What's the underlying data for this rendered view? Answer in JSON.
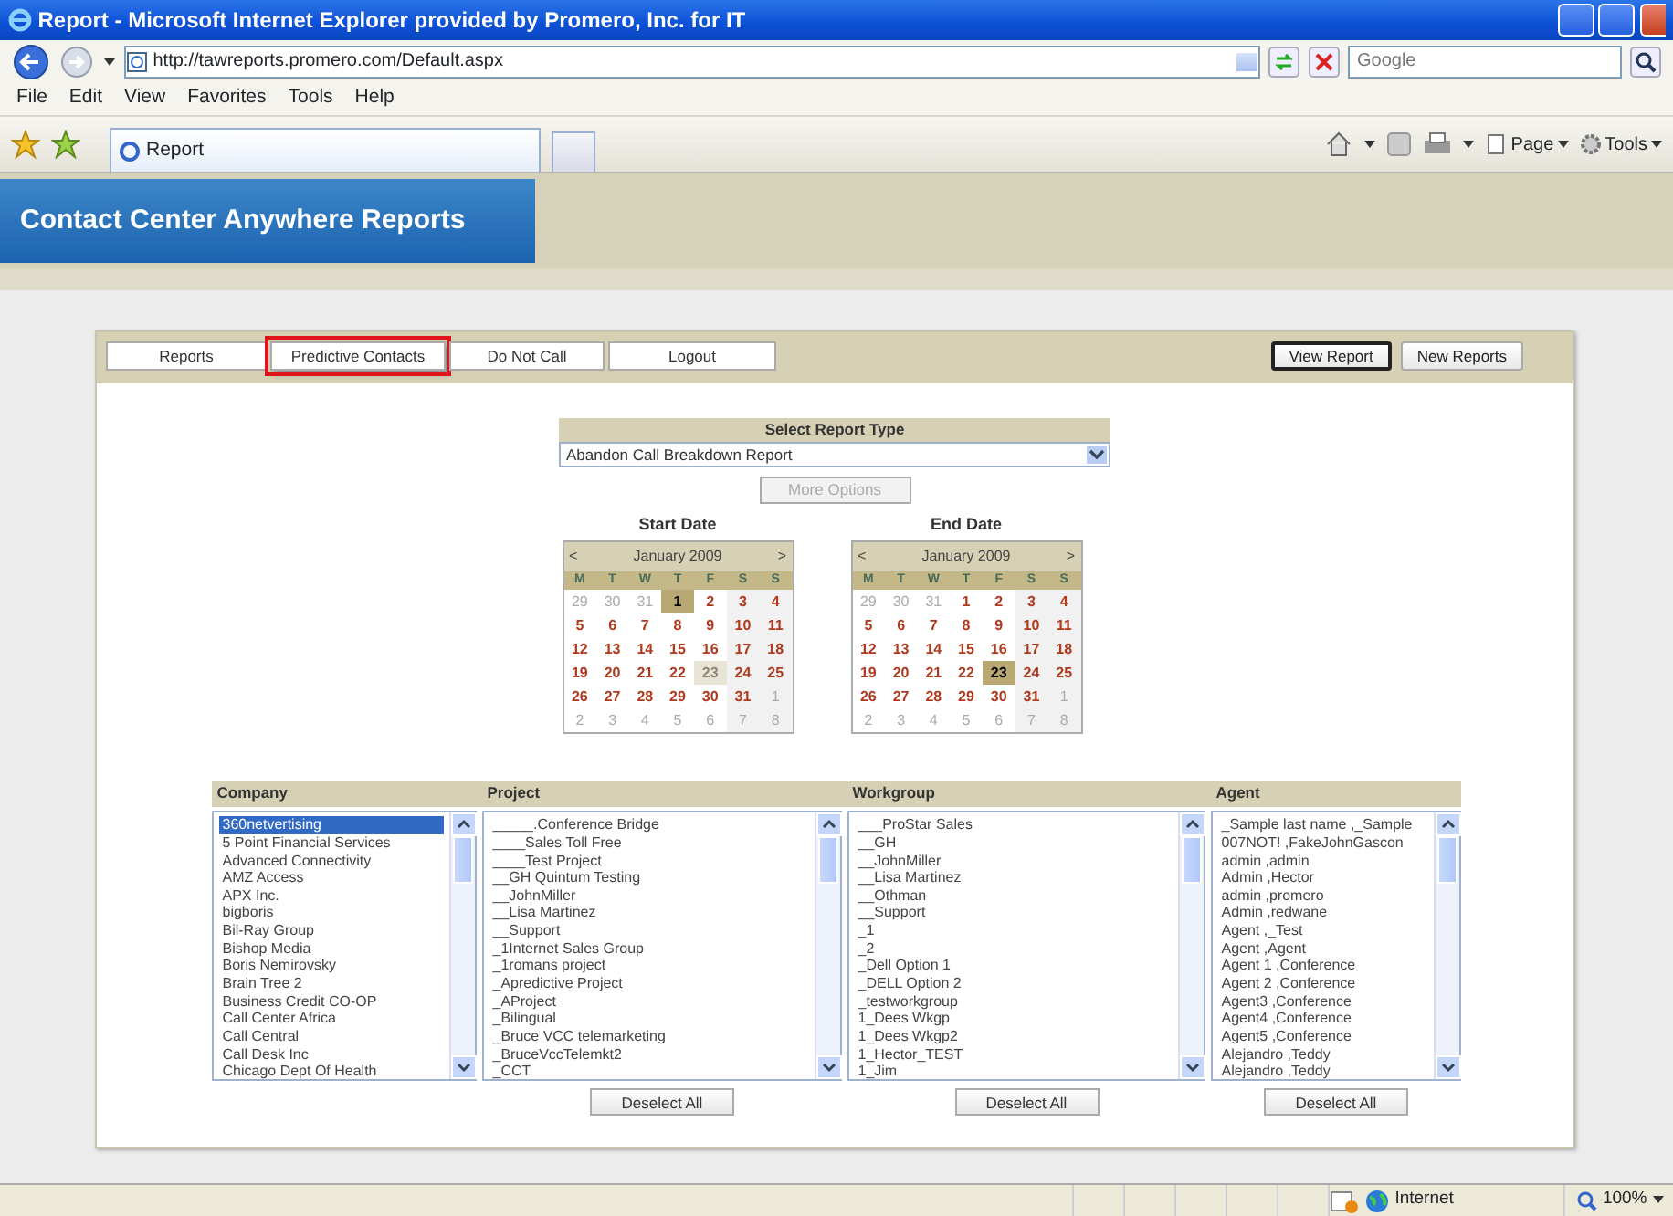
{
  "window": {
    "title": "Report - Microsoft Internet Explorer provided by Promero, Inc. for IT"
  },
  "address_bar": {
    "url": "http://tawreports.promero.com/Default.aspx",
    "search_placeholder": "Google"
  },
  "menu": [
    "File",
    "Edit",
    "View",
    "Favorites",
    "Tools",
    "Help"
  ],
  "browser_tabs": [
    {
      "label": "Report",
      "selected": true
    }
  ],
  "command_bar": [
    "Page",
    "Tools"
  ],
  "app_header": {
    "title": "Contact Center Anywhere Reports"
  },
  "nav_tabs": [
    {
      "label": "Reports",
      "highlighted": false
    },
    {
      "label": "Predictive Contacts",
      "highlighted": true
    },
    {
      "label": "Do Not Call",
      "highlighted": false
    },
    {
      "label": "Logout",
      "highlighted": false
    }
  ],
  "action_buttons": [
    {
      "label": "View Report",
      "focused": true
    },
    {
      "label": "New Reports",
      "focused": false
    }
  ],
  "report_type": {
    "heading": "Select Report Type",
    "value": "Abandon Call Breakdown Report",
    "more_options": {
      "label": "More Options",
      "disabled": true
    }
  },
  "calendars": [
    {
      "label": "Start Date",
      "prev": "<",
      "month": "January 2009",
      "next": ">",
      "weekdays": [
        "M",
        "T",
        "W",
        "T",
        "F",
        "S",
        "S"
      ],
      "weeks": [
        [
          {
            "day": "29",
            "other_month": true,
            "selected": false,
            "today": false
          },
          {
            "day": "30",
            "other_month": true,
            "selected": false,
            "today": false
          },
          {
            "day": "31",
            "other_month": true,
            "selected": false,
            "today": false
          },
          {
            "day": "1",
            "other_month": false,
            "selected": true,
            "today": false
          },
          {
            "day": "2",
            "other_month": false,
            "selected": false,
            "today": false
          },
          {
            "day": "3",
            "other_month": false,
            "selected": false,
            "today": false
          },
          {
            "day": "4",
            "other_month": false,
            "selected": false,
            "today": false
          }
        ],
        [
          {
            "day": "5",
            "other_month": false,
            "selected": false,
            "today": false
          },
          {
            "day": "6",
            "other_month": false,
            "selected": false,
            "today": false
          },
          {
            "day": "7",
            "other_month": false,
            "selected": false,
            "today": false
          },
          {
            "day": "8",
            "other_month": false,
            "selected": false,
            "today": false
          },
          {
            "day": "9",
            "other_month": false,
            "selected": false,
            "today": false
          },
          {
            "day": "10",
            "other_month": false,
            "selected": false,
            "today": false
          },
          {
            "day": "11",
            "other_month": false,
            "selected": false,
            "today": false
          }
        ],
        [
          {
            "day": "12",
            "other_month": false,
            "selected": false,
            "today": false
          },
          {
            "day": "13",
            "other_month": false,
            "selected": false,
            "today": false
          },
          {
            "day": "14",
            "other_month": false,
            "selected": false,
            "today": false
          },
          {
            "day": "15",
            "other_month": false,
            "selected": false,
            "today": false
          },
          {
            "day": "16",
            "other_month": false,
            "selected": false,
            "today": false
          },
          {
            "day": "17",
            "other_month": false,
            "selected": false,
            "today": false
          },
          {
            "day": "18",
            "other_month": false,
            "selected": false,
            "today": false
          }
        ],
        [
          {
            "day": "19",
            "other_month": false,
            "selected": false,
            "today": false
          },
          {
            "day": "20",
            "other_month": false,
            "selected": false,
            "today": false
          },
          {
            "day": "21",
            "other_month": false,
            "selected": false,
            "today": false
          },
          {
            "day": "22",
            "other_month": false,
            "selected": false,
            "today": false
          },
          {
            "day": "23",
            "other_month": false,
            "selected": false,
            "today": true
          },
          {
            "day": "24",
            "other_month": false,
            "selected": false,
            "today": false
          },
          {
            "day": "25",
            "other_month": false,
            "selected": false,
            "today": false
          }
        ],
        [
          {
            "day": "26",
            "other_month": false,
            "selected": false,
            "today": false
          },
          {
            "day": "27",
            "other_month": false,
            "selected": false,
            "today": false
          },
          {
            "day": "28",
            "other_month": false,
            "selected": false,
            "today": false
          },
          {
            "day": "29",
            "other_month": false,
            "selected": false,
            "today": false
          },
          {
            "day": "30",
            "other_month": false,
            "selected": false,
            "today": false
          },
          {
            "day": "31",
            "other_month": false,
            "selected": false,
            "today": false
          },
          {
            "day": "1",
            "other_month": true,
            "selected": false,
            "today": false
          }
        ],
        [
          {
            "day": "2",
            "other_month": true,
            "selected": false,
            "today": false
          },
          {
            "day": "3",
            "other_month": true,
            "selected": false,
            "today": false
          },
          {
            "day": "4",
            "other_month": true,
            "selected": false,
            "today": false
          },
          {
            "day": "5",
            "other_month": true,
            "selected": false,
            "today": false
          },
          {
            "day": "6",
            "other_month": true,
            "selected": false,
            "today": false
          },
          {
            "day": "7",
            "other_month": true,
            "selected": false,
            "today": false
          },
          {
            "day": "8",
            "other_month": true,
            "selected": false,
            "today": false
          }
        ]
      ]
    },
    {
      "label": "End Date",
      "prev": "<",
      "month": "January 2009",
      "next": ">",
      "weekdays": [
        "M",
        "T",
        "W",
        "T",
        "F",
        "S",
        "S"
      ],
      "weeks": [
        [
          {
            "day": "29",
            "other_month": true,
            "selected": false,
            "today": false
          },
          {
            "day": "30",
            "other_month": true,
            "selected": false,
            "today": false
          },
          {
            "day": "31",
            "other_month": true,
            "selected": false,
            "today": false
          },
          {
            "day": "1",
            "other_month": false,
            "selected": false,
            "today": false
          },
          {
            "day": "2",
            "other_month": false,
            "selected": false,
            "today": false
          },
          {
            "day": "3",
            "other_month": false,
            "selected": false,
            "today": false
          },
          {
            "day": "4",
            "other_month": false,
            "selected": false,
            "today": false
          }
        ],
        [
          {
            "day": "5",
            "other_month": false,
            "selected": false,
            "today": false
          },
          {
            "day": "6",
            "other_month": false,
            "selected": false,
            "today": false
          },
          {
            "day": "7",
            "other_month": false,
            "selected": false,
            "today": false
          },
          {
            "day": "8",
            "other_month": false,
            "selected": false,
            "today": false
          },
          {
            "day": "9",
            "other_month": false,
            "selected": false,
            "today": false
          },
          {
            "day": "10",
            "other_month": false,
            "selected": false,
            "today": false
          },
          {
            "day": "11",
            "other_month": false,
            "selected": false,
            "today": false
          }
        ],
        [
          {
            "day": "12",
            "other_month": false,
            "selected": false,
            "today": false
          },
          {
            "day": "13",
            "other_month": false,
            "selected": false,
            "today": false
          },
          {
            "day": "14",
            "other_month": false,
            "selected": false,
            "today": false
          },
          {
            "day": "15",
            "other_month": false,
            "selected": false,
            "today": false
          },
          {
            "day": "16",
            "other_month": false,
            "selected": false,
            "today": false
          },
          {
            "day": "17",
            "other_month": false,
            "selected": false,
            "today": false
          },
          {
            "day": "18",
            "other_month": false,
            "selected": false,
            "today": false
          }
        ],
        [
          {
            "day": "19",
            "other_month": false,
            "selected": false,
            "today": false
          },
          {
            "day": "20",
            "other_month": false,
            "selected": false,
            "today": false
          },
          {
            "day": "21",
            "other_month": false,
            "selected": false,
            "today": false
          },
          {
            "day": "22",
            "other_month": false,
            "selected": false,
            "today": false
          },
          {
            "day": "23",
            "other_month": false,
            "selected": true,
            "today": false
          },
          {
            "day": "24",
            "other_month": false,
            "selected": false,
            "today": false
          },
          {
            "day": "25",
            "other_month": false,
            "selected": false,
            "today": false
          }
        ],
        [
          {
            "day": "26",
            "other_month": false,
            "selected": false,
            "today": false
          },
          {
            "day": "27",
            "other_month": false,
            "selected": false,
            "today": false
          },
          {
            "day": "28",
            "other_month": false,
            "selected": false,
            "today": false
          },
          {
            "day": "29",
            "other_month": false,
            "selected": false,
            "today": false
          },
          {
            "day": "30",
            "other_month": false,
            "selected": false,
            "today": false
          },
          {
            "day": "31",
            "other_month": false,
            "selected": false,
            "today": false
          },
          {
            "day": "1",
            "other_month": true,
            "selected": false,
            "today": false
          }
        ],
        [
          {
            "day": "2",
            "other_month": true,
            "selected": false,
            "today": false
          },
          {
            "day": "3",
            "other_month": true,
            "selected": false,
            "today": false
          },
          {
            "day": "4",
            "other_month": true,
            "selected": false,
            "today": false
          },
          {
            "day": "5",
            "other_month": true,
            "selected": false,
            "today": false
          },
          {
            "day": "6",
            "other_month": true,
            "selected": false,
            "today": false
          },
          {
            "day": "7",
            "other_month": true,
            "selected": false,
            "today": false
          },
          {
            "day": "8",
            "other_month": true,
            "selected": false,
            "today": false
          }
        ]
      ]
    }
  ],
  "filters": [
    {
      "heading": "Company",
      "items": [
        {
          "label": "360netvertising",
          "selected": true
        },
        {
          "label": "5 Point Financial Services",
          "selected": false
        },
        {
          "label": "Advanced Connectivity",
          "selected": false
        },
        {
          "label": "AMZ Access",
          "selected": false
        },
        {
          "label": "APX Inc.",
          "selected": false
        },
        {
          "label": "bigboris",
          "selected": false
        },
        {
          "label": "Bil-Ray Group",
          "selected": false
        },
        {
          "label": "Bishop Media",
          "selected": false
        },
        {
          "label": "Boris Nemirovsky",
          "selected": false
        },
        {
          "label": "Brain Tree 2",
          "selected": false
        },
        {
          "label": "Business Credit CO-OP",
          "selected": false
        },
        {
          "label": "Call Center Africa",
          "selected": false
        },
        {
          "label": "Call Central",
          "selected": false
        },
        {
          "label": "Call Desk Inc",
          "selected": false
        },
        {
          "label": "Chicago Dept Of Health",
          "selected": false
        }
      ]
    },
    {
      "heading": "Project",
      "deselect_button": "Deselect All",
      "items": [
        {
          "label": "_____.Conference Bridge",
          "selected": false
        },
        {
          "label": "____Sales Toll Free",
          "selected": false
        },
        {
          "label": "____Test Project",
          "selected": false
        },
        {
          "label": "__GH Quintum Testing",
          "selected": false
        },
        {
          "label": "__JohnMiller",
          "selected": false
        },
        {
          "label": "__Lisa Martinez",
          "selected": false
        },
        {
          "label": "__Support",
          "selected": false
        },
        {
          "label": "_1Internet Sales Group",
          "selected": false
        },
        {
          "label": "_1romans project",
          "selected": false
        },
        {
          "label": "_Apredictive Project",
          "selected": false
        },
        {
          "label": "_AProject",
          "selected": false
        },
        {
          "label": "_Bilingual",
          "selected": false
        },
        {
          "label": "_Bruce VCC telemarketing",
          "selected": false
        },
        {
          "label": "_BruceVccTelemkt2",
          "selected": false
        },
        {
          "label": "_CCT",
          "selected": false
        }
      ]
    },
    {
      "heading": "Workgroup",
      "deselect_button": "Deselect All",
      "items": [
        {
          "label": "___ProStar Sales",
          "selected": false
        },
        {
          "label": "__GH",
          "selected": false
        },
        {
          "label": "__JohnMiller",
          "selected": false
        },
        {
          "label": "__Lisa Martinez",
          "selected": false
        },
        {
          "label": "__Othman",
          "selected": false
        },
        {
          "label": "__Support",
          "selected": false
        },
        {
          "label": "_1",
          "selected": false
        },
        {
          "label": "_2",
          "selected": false
        },
        {
          "label": "_Dell Option 1",
          "selected": false
        },
        {
          "label": "_DELL Option 2",
          "selected": false
        },
        {
          "label": "_testworkgroup",
          "selected": false
        },
        {
          "label": "1_Dees Wkgp",
          "selected": false
        },
        {
          "label": "1_Dees Wkgp2",
          "selected": false
        },
        {
          "label": "1_Hector_TEST",
          "selected": false
        },
        {
          "label": "1_Jim",
          "selected": false
        }
      ]
    },
    {
      "heading": "Agent",
      "deselect_button": "Deselect All",
      "items": [
        {
          "label": "_Sample last name ,_Sample",
          "selected": false
        },
        {
          "label": "007NOT! ,FakeJohnGascon",
          "selected": false
        },
        {
          "label": "admin ,admin",
          "selected": false
        },
        {
          "label": "Admin ,Hector",
          "selected": false
        },
        {
          "label": "admin ,promero",
          "selected": false
        },
        {
          "label": "Admin ,redwane",
          "selected": false
        },
        {
          "label": "Agent ,_Test",
          "selected": false
        },
        {
          "label": "Agent ,Agent",
          "selected": false
        },
        {
          "label": "Agent 1 ,Conference",
          "selected": false
        },
        {
          "label": "Agent 2 ,Conference",
          "selected": false
        },
        {
          "label": "Agent3 ,Conference",
          "selected": false
        },
        {
          "label": "Agent4 ,Conference",
          "selected": false
        },
        {
          "label": "Agent5 ,Conference",
          "selected": false
        },
        {
          "label": "Alejandro ,Teddy",
          "selected": false
        },
        {
          "label": "Alejandro ,Teddy",
          "selected": false
        }
      ]
    }
  ],
  "status_bar": {
    "zone": "Internet",
    "zoom": "100%"
  }
}
